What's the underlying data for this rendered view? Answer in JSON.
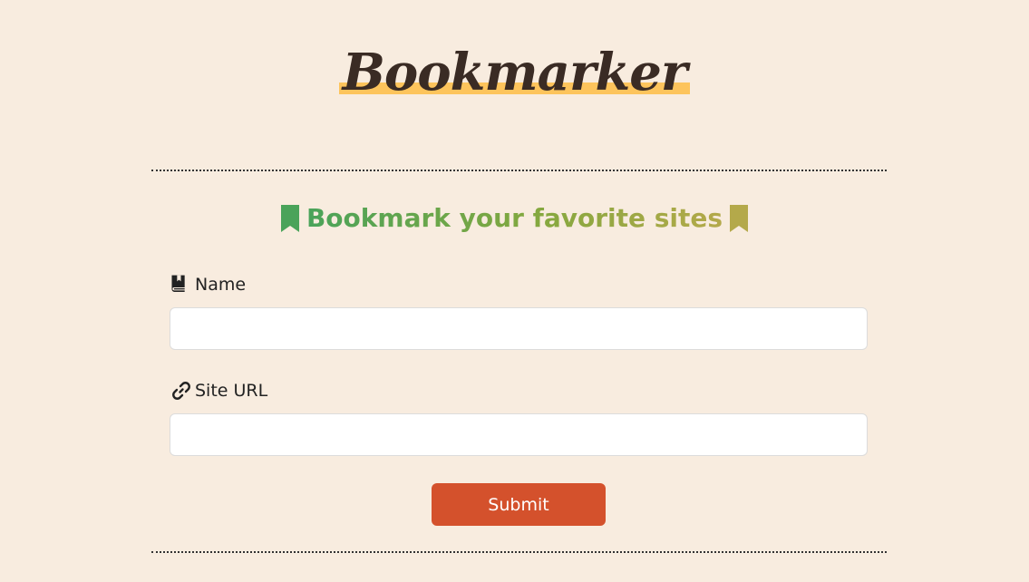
{
  "header": {
    "logo_text": "Bookmarker"
  },
  "form": {
    "heading": "Bookmark your favorite sites",
    "name_field": {
      "label": "Name",
      "value": "",
      "placeholder": ""
    },
    "url_field": {
      "label": "Site URL",
      "value": "",
      "placeholder": ""
    },
    "submit_label": "Submit"
  },
  "icons": {
    "heading_left": "bookmark-icon",
    "heading_right": "bookmark-icon",
    "name_label": "book-bookmark-icon",
    "url_label": "link-icon"
  },
  "colors": {
    "background": "#f8ecdf",
    "logo_text": "#3a2b24",
    "logo_highlight": "#fdc45c",
    "heading_green": "#4aa35a",
    "heading_olive": "#b4a94a",
    "submit_button": "#d4512c"
  }
}
